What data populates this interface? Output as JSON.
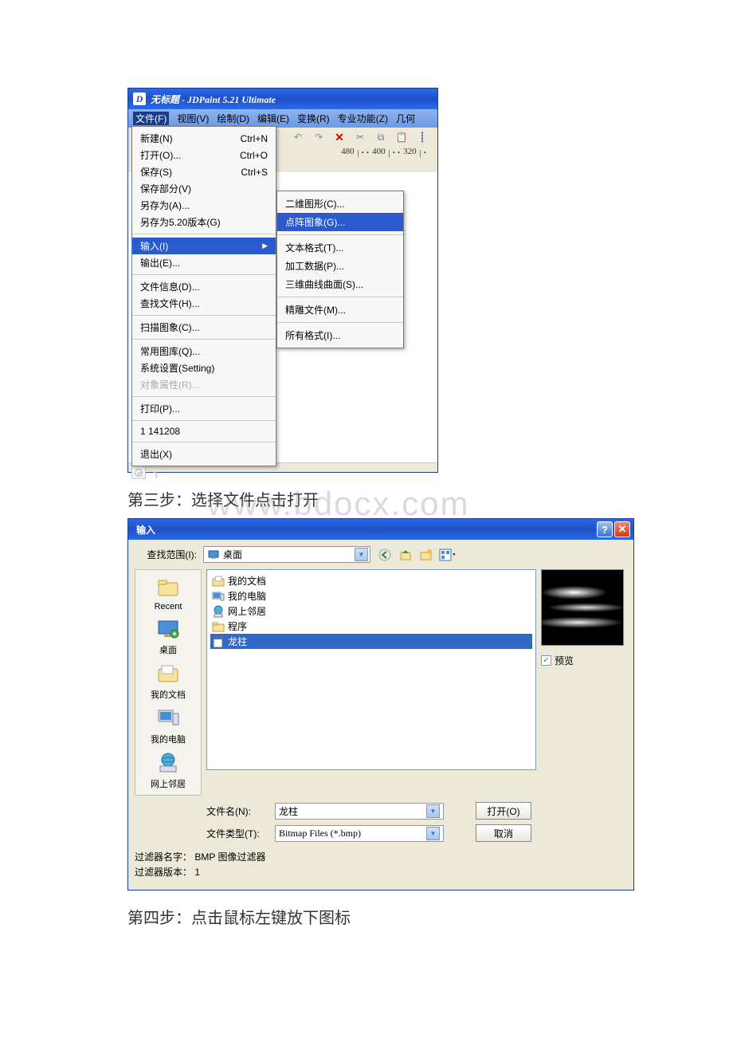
{
  "app": {
    "title": "无标题 - JDPaint 5.21 Ultimate",
    "menubar": [
      "文件(F)",
      "视图(V)",
      "绘制(D)",
      "编辑(E)",
      "变换(R)",
      "专业功能(Z)",
      "几何"
    ],
    "ruler": [
      "480",
      "400",
      "320"
    ],
    "file_menu": {
      "groups": [
        [
          {
            "label": "新建(N)",
            "shortcut": "Ctrl+N"
          },
          {
            "label": "打开(O)...",
            "shortcut": "Ctrl+O"
          },
          {
            "label": "保存(S)",
            "shortcut": "Ctrl+S"
          },
          {
            "label": "保存部分(V)",
            "shortcut": ""
          },
          {
            "label": "另存为(A)...",
            "shortcut": ""
          },
          {
            "label": "另存为5.20版本(G)",
            "shortcut": ""
          }
        ],
        [
          {
            "label": "输入(I)",
            "shortcut": "",
            "highlighted": true,
            "arrow": true
          },
          {
            "label": "输出(E)...",
            "shortcut": ""
          }
        ],
        [
          {
            "label": "文件信息(D)...",
            "shortcut": ""
          },
          {
            "label": "查找文件(H)...",
            "shortcut": ""
          }
        ],
        [
          {
            "label": "扫描图象(C)...",
            "shortcut": ""
          }
        ],
        [
          {
            "label": "常用图库(Q)...",
            "shortcut": ""
          },
          {
            "label": "系统设置(Setting)",
            "shortcut": ""
          },
          {
            "label": "对象属性(R)...",
            "shortcut": "",
            "disabled": true
          }
        ],
        [
          {
            "label": "打印(P)...",
            "shortcut": ""
          }
        ],
        [
          {
            "label": "1 141208",
            "shortcut": ""
          }
        ],
        [
          {
            "label": "退出(X)",
            "shortcut": ""
          }
        ]
      ]
    },
    "submenu": {
      "groups": [
        [
          {
            "label": "二维图形(C)..."
          },
          {
            "label": "点阵图象(G)...",
            "highlighted": true
          }
        ],
        [
          {
            "label": "文本格式(T)..."
          },
          {
            "label": "加工数据(P)..."
          },
          {
            "label": "三维曲线曲面(S)..."
          }
        ],
        [
          {
            "label": "精雕文件(M)..."
          }
        ],
        [
          {
            "label": "所有格式(I)..."
          }
        ]
      ]
    }
  },
  "step3": "第三步：选择文件点击打开",
  "watermark": "www.bdocx.com",
  "dialog": {
    "title": "输入",
    "lookin_label": "查找范围(I):",
    "lookin_value": "桌面",
    "places": [
      "Recent",
      "桌面",
      "我的文档",
      "我的电脑",
      "网上邻居"
    ],
    "files": [
      {
        "name": "我的文档",
        "type": "folder-docs"
      },
      {
        "name": "我的电脑",
        "type": "computer"
      },
      {
        "name": "网上邻居",
        "type": "network"
      },
      {
        "name": "程序",
        "type": "folder"
      },
      {
        "name": "龙柱",
        "type": "file",
        "selected": true
      }
    ],
    "preview_label": "预览",
    "filename_label": "文件名(N):",
    "filename_value": "龙柱",
    "filetype_label": "文件类型(T):",
    "filetype_value": "Bitmap Files (*.bmp)",
    "open_btn": "打开(O)",
    "cancel_btn": "取消",
    "filter_name_label": "过滤器名字：",
    "filter_name_value": "BMP 图像过滤器",
    "filter_ver_label": "过滤器版本：",
    "filter_ver_value": "1"
  },
  "step4": "第四步：点击鼠标左键放下图标"
}
